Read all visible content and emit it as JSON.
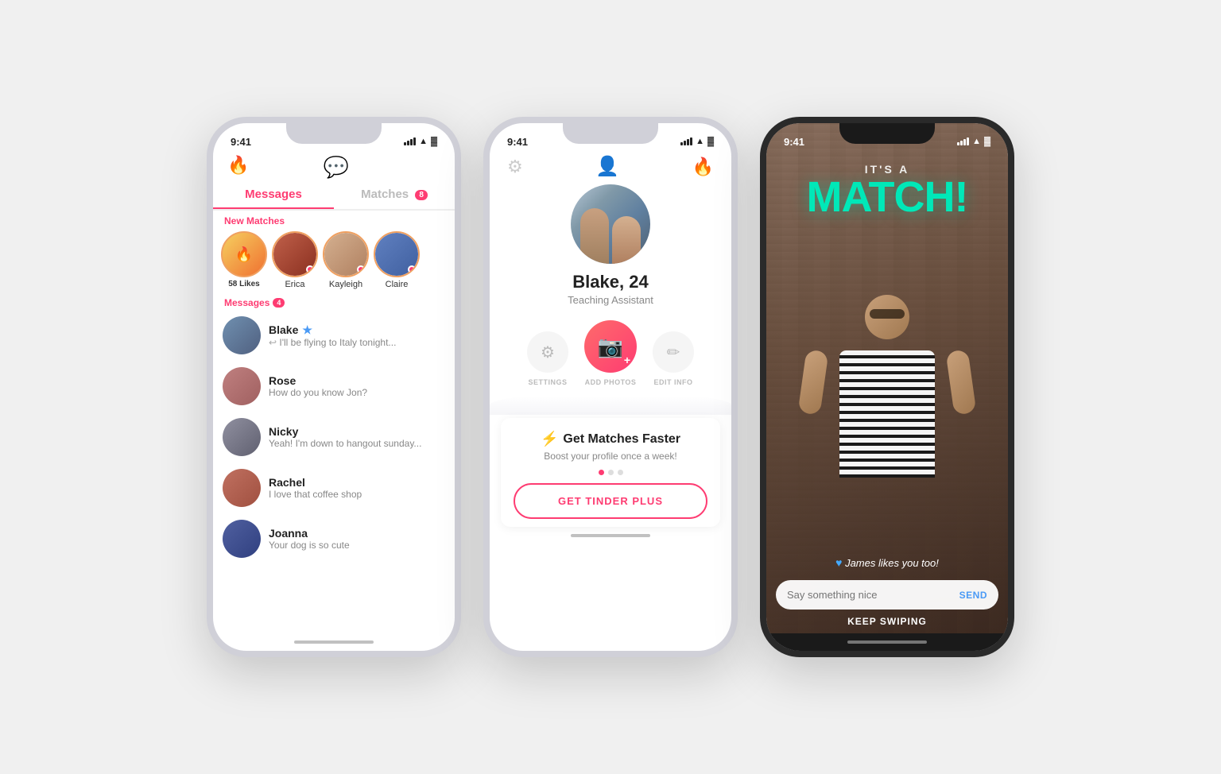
{
  "phone1": {
    "status": {
      "time": "9:41",
      "battery": "▓▓▓",
      "wifi": "WiFi",
      "signal": "●●●"
    },
    "header": {
      "chat_icon": "💬",
      "tinder_icon": "🔥"
    },
    "tabs": {
      "messages_label": "Messages",
      "matches_label": "Matches",
      "matches_badge": "8"
    },
    "new_matches_label": "New Matches",
    "new_matches": [
      {
        "id": "likes",
        "label": "58 Likes",
        "count": "58",
        "is_likes": true
      },
      {
        "id": "erica",
        "label": "Erica",
        "is_likes": false
      },
      {
        "id": "kayleigh",
        "label": "Kayleigh",
        "is_likes": false
      },
      {
        "id": "claire",
        "label": "Claire",
        "is_likes": false
      }
    ],
    "messages_label": "Messages",
    "messages_badge": "4",
    "messages": [
      {
        "name": "Blake",
        "has_star": true,
        "preview": "← I'll be flying to Italy tonight...",
        "avatar_class": "av-blake"
      },
      {
        "name": "Rose",
        "has_star": false,
        "preview": "How do you know Jon?",
        "avatar_class": "av-rose"
      },
      {
        "name": "Nicky",
        "has_star": false,
        "preview": "Yeah! I'm down to hangout sunday...",
        "avatar_class": "av-nicky"
      },
      {
        "name": "Rachel",
        "has_star": false,
        "preview": "I love that coffee shop",
        "avatar_class": "av-rachel"
      },
      {
        "name": "Joanna",
        "has_star": false,
        "preview": "Your dog is so cute",
        "avatar_class": "av-joanna"
      }
    ]
  },
  "phone2": {
    "status": {
      "time": "9:41"
    },
    "profile": {
      "name": "Blake, 24",
      "job": "Teaching Assistant"
    },
    "actions": {
      "settings_label": "SETTINGS",
      "add_photos_label": "ADD PHOTOS",
      "edit_info_label": "EDIT INFO"
    },
    "promo": {
      "bolt": "⚡",
      "title": "Get Matches Faster",
      "subtitle": "Boost your profile once a week!"
    },
    "cta_label": "GET TINDER PLUS"
  },
  "phone3": {
    "status": {
      "time": "9:41"
    },
    "match": {
      "its_a": "IT'S A",
      "match_text": "MATCH!",
      "sub_text": "James likes you too!",
      "heart": "♥"
    },
    "input": {
      "placeholder": "Say something nice",
      "send_label": "SEND"
    },
    "keep_swiping": "KEEP SWIPING"
  }
}
